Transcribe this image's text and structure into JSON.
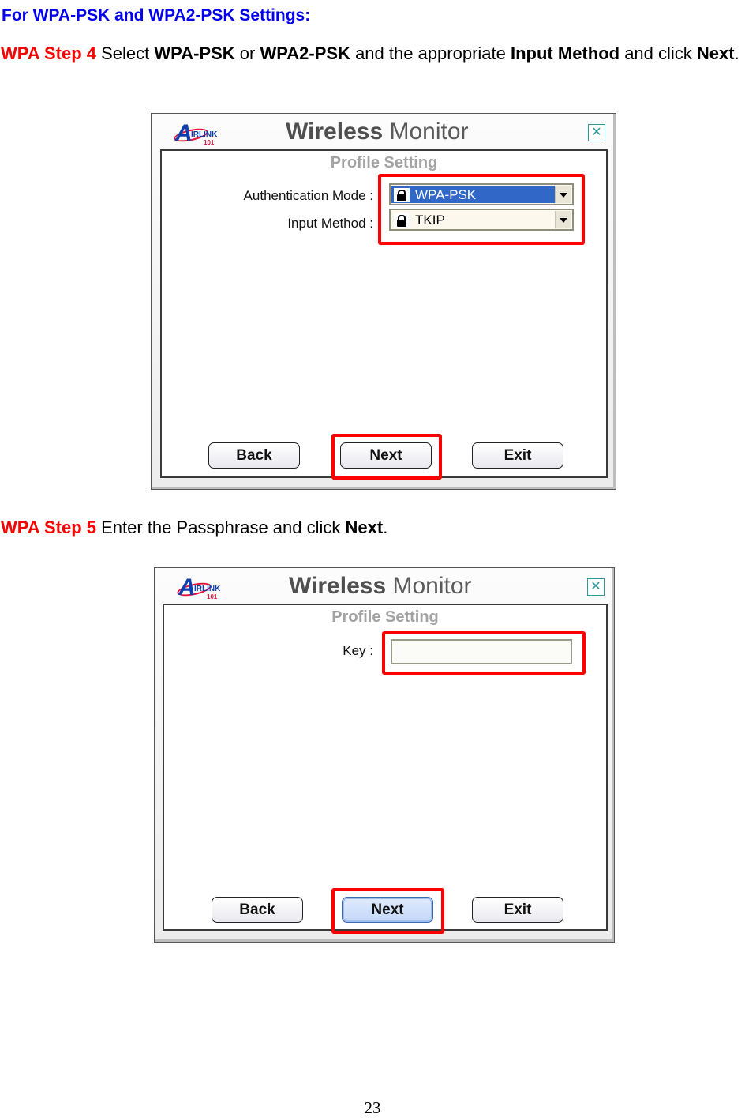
{
  "document": {
    "heading": "For WPA-PSK and WPA2-PSK Settings:",
    "step4": {
      "step_label": "WPA Step 4",
      "t1": " Select ",
      "b1": "WPA-PSK",
      "t2": " or ",
      "b2": "WPA2-PSK",
      "t3": " and the appropriate ",
      "b3": "Input Method",
      "t4": " and click ",
      "b4": "Next",
      "t5": "."
    },
    "step5": {
      "step_label": "WPA Step 5",
      "t1": " Enter the Passphrase and click ",
      "b1": "Next",
      "t2": "."
    },
    "page_number": "23"
  },
  "dialog1": {
    "logo_letter": "A",
    "logo_word": "IRLINK",
    "logo_num": "101",
    "title_bold": "Wireless",
    "title_rest": " Monitor",
    "close_glyph": "✕",
    "subtitle": "Profile Setting",
    "auth_label": "Authentication Mode :",
    "auth_value": "WPA-PSK",
    "input_label": "Input Method :",
    "input_value": "TKIP",
    "buttons": {
      "back": "Back",
      "next": "Next",
      "exit": "Exit"
    },
    "highlight_color": "#ff0000"
  },
  "dialog2": {
    "logo_letter": "A",
    "logo_word": "IRLINK",
    "logo_num": "101",
    "title_bold": "Wireless",
    "title_rest": " Monitor",
    "close_glyph": "✕",
    "subtitle": "Profile Setting",
    "key_label": "Key :",
    "key_value": "",
    "buttons": {
      "back": "Back",
      "next": "Next",
      "exit": "Exit"
    },
    "highlight_color": "#ff0000"
  }
}
